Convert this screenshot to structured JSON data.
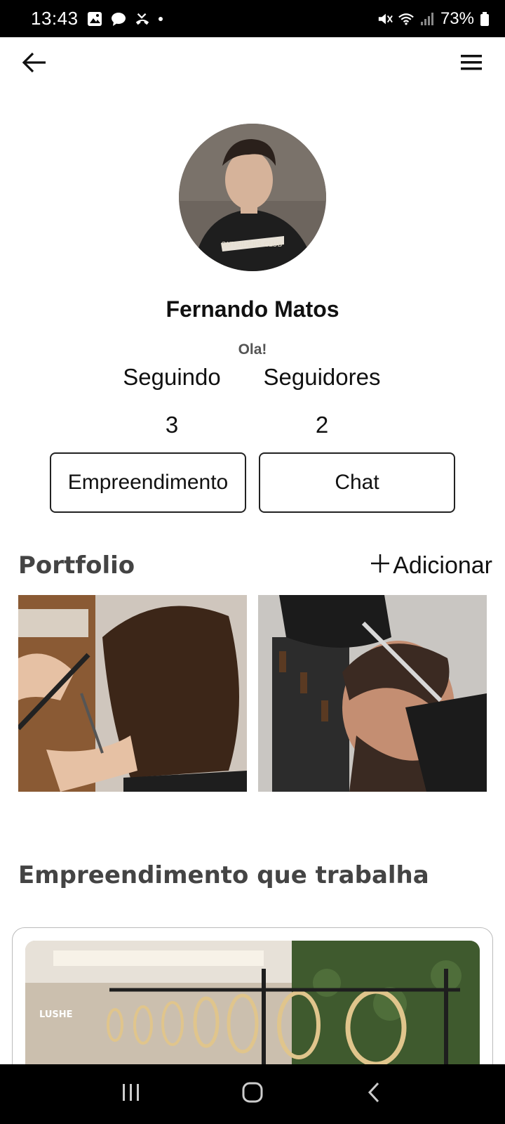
{
  "status_bar": {
    "time": "13:43",
    "battery": "73%",
    "icons": [
      "image-icon",
      "chat-bubble-icon",
      "missed-call-icon",
      "dot-icon",
      "mute-icon",
      "wifi-icon",
      "signal-icon",
      "battery-icon"
    ]
  },
  "app_bar": {
    "back_icon": "arrow-left-icon",
    "menu_icon": "hamburger-menu-icon"
  },
  "profile": {
    "name": "Fernando Matos",
    "bio": "Ola!",
    "following_label": "Seguindo",
    "following_count": "3",
    "followers_label": "Seguidores",
    "followers_count": "2",
    "business_button": "Empreendimento",
    "chat_button": "Chat"
  },
  "portfolio": {
    "title": "Portfolio",
    "add_label": "Adicionar"
  },
  "work": {
    "title": "Empreendimento que trabalha",
    "business_logo_text": "LUSHE"
  },
  "colors": {
    "accent": "#000000",
    "section_title": "#444444",
    "muted": "#555555"
  }
}
